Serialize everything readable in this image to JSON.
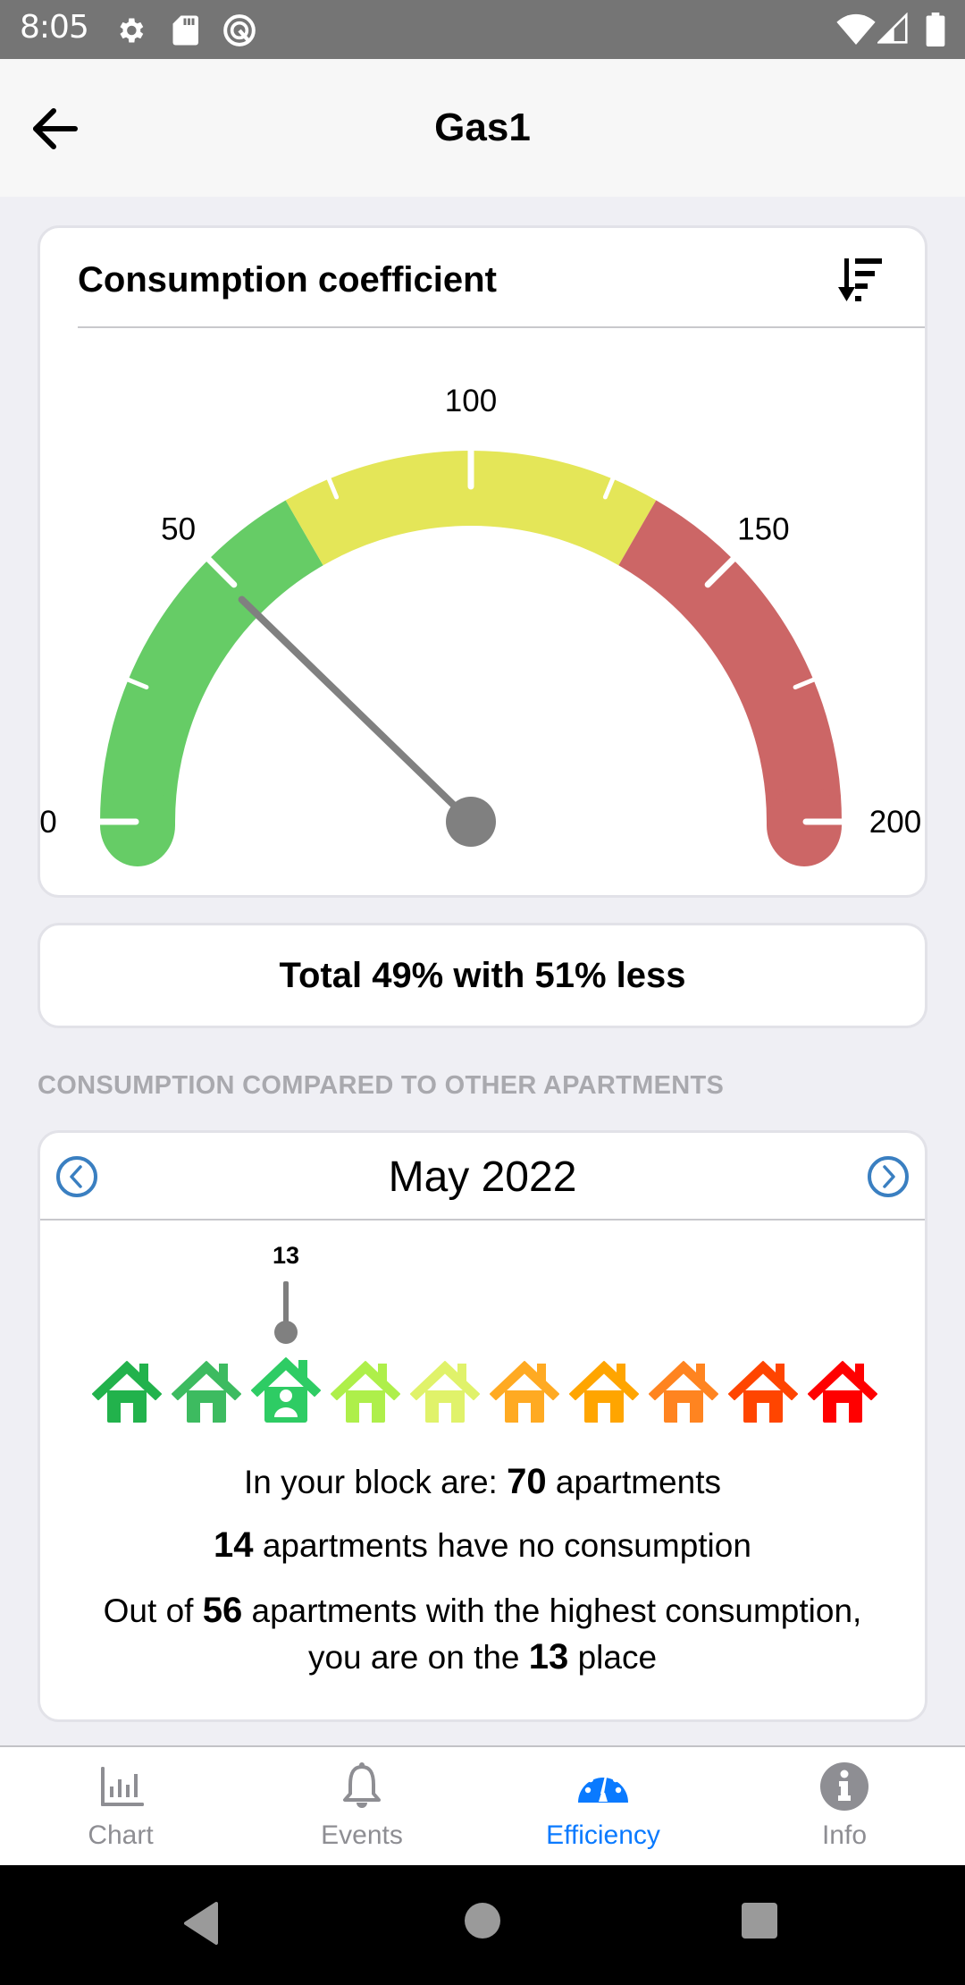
{
  "status_bar": {
    "time": "8:05",
    "left_icons": [
      "settings-icon",
      "sd-card-icon",
      "app-notification-icon"
    ],
    "right_icons": [
      "wifi-icon",
      "signal-icon",
      "battery-icon"
    ]
  },
  "header": {
    "title": "Gas1",
    "back_icon": "arrow-left-icon"
  },
  "gauge_card": {
    "title": "Consumption coefficient",
    "sort_icon": "sort-descending-icon"
  },
  "chart_data": {
    "type": "gauge",
    "title": "Consumption coefficient",
    "min": 0,
    "max": 200,
    "value": 49,
    "major_ticks": [
      0,
      50,
      100,
      150,
      200
    ],
    "tick_labels": [
      "0",
      "50",
      "100",
      "150",
      "200"
    ],
    "minor_ticks": [
      25,
      75,
      125,
      175
    ],
    "bands": [
      {
        "from": 0,
        "to": 66.7,
        "color": "#66cc66",
        "name": "low"
      },
      {
        "from": 66.7,
        "to": 133.3,
        "color": "#e4e658",
        "name": "medium"
      },
      {
        "from": 133.3,
        "to": 200,
        "color": "#cc6666",
        "name": "high"
      }
    ],
    "needle_color": "#808080"
  },
  "total": {
    "text": "Total 49% with 51% less"
  },
  "section": {
    "label": "CONSUMPTION COMPARED TO OTHER APARTMENTS"
  },
  "compare": {
    "month": "May 2022",
    "prev_icon": "chevron-left-circle-icon",
    "next_icon": "chevron-right-circle-icon",
    "accent": "#3a7fc1",
    "rank_label": "13",
    "selected_index": 2,
    "houses": [
      {
        "color": "#22b24c"
      },
      {
        "color": "#3dbb60"
      },
      {
        "color": "#2ecc64",
        "current": true
      },
      {
        "color": "#aeef4a"
      },
      {
        "color": "#e0f26a"
      },
      {
        "color": "#ffaa22"
      },
      {
        "color": "#ffa500"
      },
      {
        "color": "#ff8420"
      },
      {
        "color": "#ff4500"
      },
      {
        "color": "#ff0000"
      }
    ],
    "line1": {
      "prefix": "In your block are: ",
      "value": "70",
      "suffix": " apartments"
    },
    "line2": {
      "value": "14",
      "suffix": " apartments have no consumption"
    },
    "line3": {
      "prefix": "Out of ",
      "value": "56",
      "suffix": " apartments with the highest consumption,"
    },
    "line4": {
      "prefix": "you are on the ",
      "value": "13",
      "suffix": " place"
    }
  },
  "tabs": [
    {
      "label": "Chart",
      "icon": "bar-chart-icon",
      "active": false
    },
    {
      "label": "Events",
      "icon": "bell-icon",
      "active": false
    },
    {
      "label": "Efficiency",
      "icon": "speedometer-icon",
      "active": true
    },
    {
      "label": "Info",
      "icon": "info-icon",
      "active": false
    }
  ],
  "colors": {
    "active_tab": "#0a7aff",
    "inactive_tab": "#8e8e93"
  }
}
